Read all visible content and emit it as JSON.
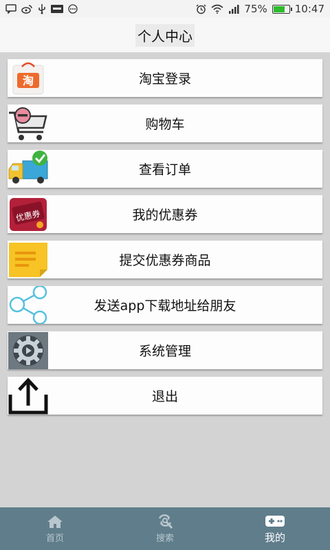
{
  "status_bar": {
    "battery_percent": "75%",
    "battery_level": 0.75,
    "time": "10:47",
    "icons_left": [
      "message-icon",
      "weibo-icon",
      "usb-icon",
      "app-icon",
      "more-icon"
    ],
    "icons_right": [
      "alarm-icon",
      "wifi-icon",
      "signal-icon",
      "battery-icon"
    ]
  },
  "header": {
    "title": "个人中心"
  },
  "menu": {
    "items": [
      {
        "label": "淘宝登录",
        "icon": "taobao-icon"
      },
      {
        "label": "购物车",
        "icon": "shopping-cart-icon"
      },
      {
        "label": "查看订单",
        "icon": "delivery-truck-icon"
      },
      {
        "label": "我的优惠券",
        "icon": "coupon-icon"
      },
      {
        "label": "提交优惠券商品",
        "icon": "note-icon"
      },
      {
        "label": "发送app下载地址给朋友",
        "icon": "share-icon"
      },
      {
        "label": "系统管理",
        "icon": "settings-gear-icon"
      },
      {
        "label": "退出",
        "icon": "exit-icon"
      }
    ],
    "taobao_icon_text": "淘",
    "coupon_icon_text": "优惠券"
  },
  "bottom_nav": {
    "tabs": [
      {
        "label": "首页",
        "icon": "home-icon"
      },
      {
        "label": "搜索",
        "icon": "search-icon"
      },
      {
        "label": "我的",
        "icon": "gamepad-icon",
        "active": true
      }
    ]
  },
  "colors": {
    "background": "#d3d3d3",
    "bottom_nav": "#5f7d8b",
    "active_tab": "#ffffff",
    "inactive_tab": "#b9c6cd",
    "battery": "#2dbb2d"
  }
}
